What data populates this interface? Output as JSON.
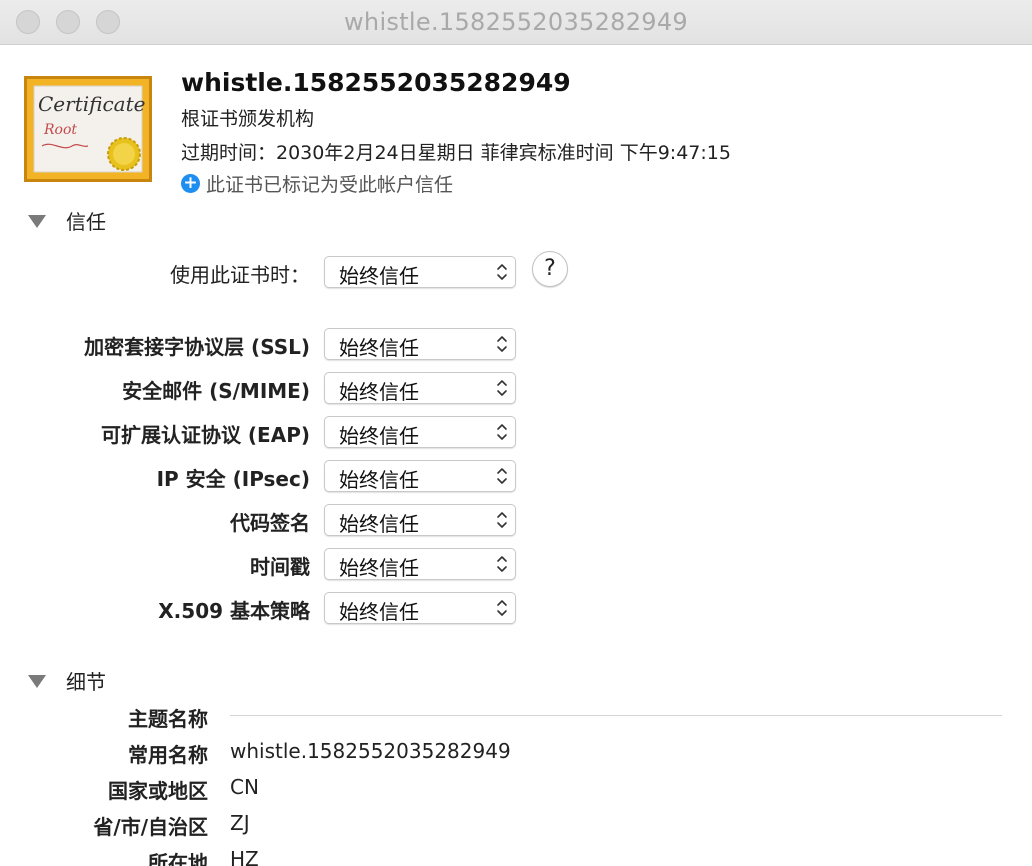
{
  "window": {
    "title": "whistle.1582552035282949"
  },
  "certificate": {
    "name": "whistle.1582552035282949",
    "type": "根证书颁发机构",
    "expiry": "过期时间：2030年2月24日星期日 菲律宾标准时间 下午9:47:15",
    "trust_note": "此证书已标记为受此帐户信任",
    "icon": {
      "script_text": "Certificate",
      "sub_text": "Root",
      "icon_name": "certificate-icon"
    }
  },
  "trust": {
    "section_title": "信任",
    "when_using": {
      "label": "使用此证书时：",
      "value": "始终信任"
    },
    "help_label": "?",
    "rows": [
      {
        "label": "加密套接字协议层 (SSL)",
        "value": "始终信任"
      },
      {
        "label": "安全邮件 (S/MIME)",
        "value": "始终信任"
      },
      {
        "label": "可扩展认证协议 (EAP)",
        "value": "始终信任"
      },
      {
        "label": "IP 安全 (IPsec)",
        "value": "始终信任"
      },
      {
        "label": "代码签名",
        "value": "始终信任"
      },
      {
        "label": "时间戳",
        "value": "始终信任"
      },
      {
        "label": "X.509 基本策略",
        "value": "始终信任"
      }
    ]
  },
  "details": {
    "section_title": "细节",
    "subject_name_label": "主题名称",
    "fields": [
      {
        "label": "常用名称",
        "value": "whistle.1582552035282949"
      },
      {
        "label": "国家或地区",
        "value": "CN"
      },
      {
        "label": "省/市/自治区",
        "value": "ZJ"
      },
      {
        "label": "所在地",
        "value": "HZ"
      }
    ]
  },
  "colors": {
    "accent": "#1e8ff0",
    "certificate_border": "#d99a12",
    "seal": "#e8c21c"
  }
}
